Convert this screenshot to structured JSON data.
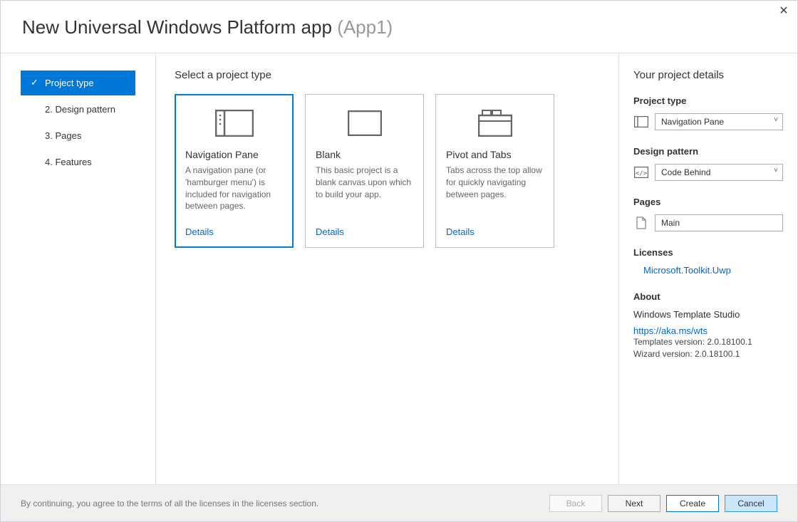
{
  "header": {
    "title": "New Universal Windows Platform app",
    "app_name": "(App1)"
  },
  "sidebar": {
    "items": [
      {
        "label": "Project type",
        "selected": true
      },
      {
        "label": "2.  Design pattern"
      },
      {
        "label": "3.  Pages"
      },
      {
        "label": "4.  Features"
      }
    ]
  },
  "content": {
    "heading": "Select a project type",
    "cards": [
      {
        "title": "Navigation Pane",
        "description": "A navigation pane (or 'hamburger menu') is included for navigation between pages.",
        "details_label": "Details",
        "selected": true
      },
      {
        "title": "Blank",
        "description": "This basic project is a blank canvas upon which to build your app.",
        "details_label": "Details"
      },
      {
        "title": "Pivot and Tabs",
        "description": "Tabs across the top allow for quickly navigating between pages.",
        "details_label": "Details"
      }
    ]
  },
  "right": {
    "heading": "Your project details",
    "project_type": {
      "label": "Project type",
      "value": "Navigation Pane"
    },
    "design_pattern": {
      "label": "Design pattern",
      "value": "Code Behind"
    },
    "pages": {
      "label": "Pages",
      "value": "Main"
    },
    "licenses": {
      "label": "Licenses",
      "link": "Microsoft.Toolkit.Uwp"
    },
    "about": {
      "label": "About",
      "product": "Windows Template Studio",
      "url": "https://aka.ms/wts",
      "templates_version": "Templates version: 2.0.18100.1",
      "wizard_version": "Wizard version: 2.0.18100.1"
    }
  },
  "footer": {
    "disclaimer": "By continuing, you agree to the terms of all the licenses in the licenses section.",
    "buttons": {
      "back": "Back",
      "next": "Next",
      "create": "Create",
      "cancel": "Cancel"
    }
  }
}
